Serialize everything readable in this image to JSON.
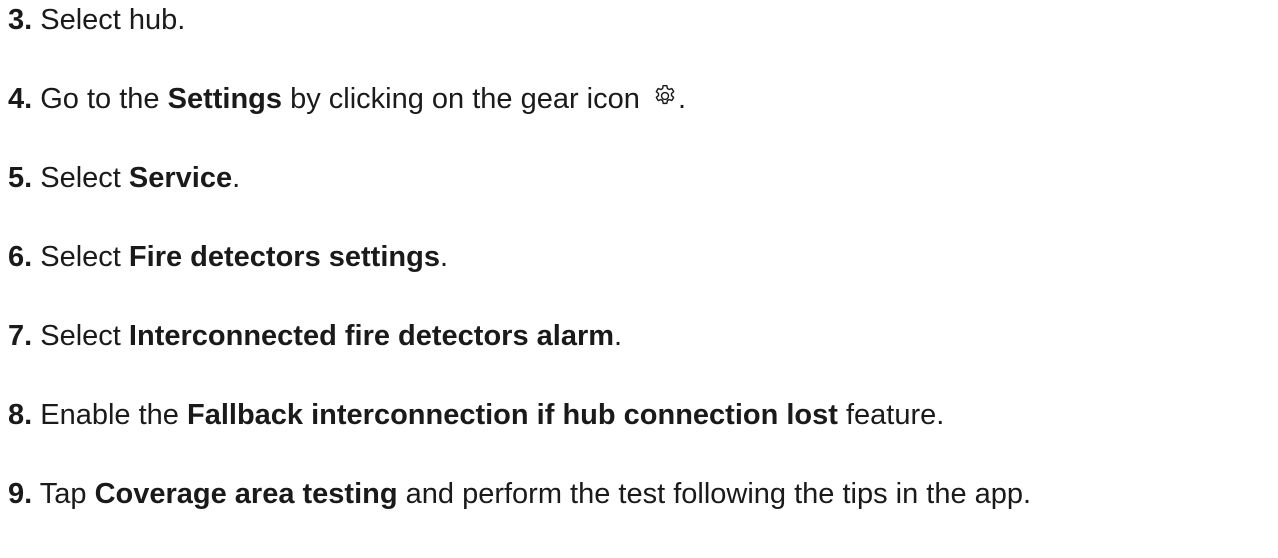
{
  "steps": [
    {
      "num": "3.",
      "parts": [
        {
          "t": "Select hub.",
          "b": false
        }
      ]
    },
    {
      "num": "4.",
      "parts": [
        {
          "t": "Go to the ",
          "b": false
        },
        {
          "t": "Settings",
          "b": true
        },
        {
          "t": " by clicking on the gear icon ",
          "b": false
        },
        {
          "icon": "gear-icon"
        },
        {
          "t": ".",
          "b": false
        }
      ]
    },
    {
      "num": "5.",
      "parts": [
        {
          "t": "Select ",
          "b": false
        },
        {
          "t": "Service",
          "b": true
        },
        {
          "t": ".",
          "b": false
        }
      ]
    },
    {
      "num": "6.",
      "parts": [
        {
          "t": "Select ",
          "b": false
        },
        {
          "t": "Fire detectors settings",
          "b": true
        },
        {
          "t": ".",
          "b": false
        }
      ]
    },
    {
      "num": "7.",
      "parts": [
        {
          "t": "Select ",
          "b": false
        },
        {
          "t": "Interconnected fire detectors alarm",
          "b": true
        },
        {
          "t": ".",
          "b": false
        }
      ]
    },
    {
      "num": "8.",
      "parts": [
        {
          "t": "Enable the ",
          "b": false
        },
        {
          "t": "Fallback interconnection if hub connection lost",
          "b": true
        },
        {
          "t": " feature.",
          "b": false
        }
      ]
    },
    {
      "num": "9.",
      "parts": [
        {
          "t": "Tap ",
          "b": false
        },
        {
          "t": "Coverage area testing",
          "b": true
        },
        {
          "t": " and perform the test following the tips in the app.",
          "b": false
        }
      ]
    }
  ],
  "colors": {
    "text": "#1a1a1a",
    "background": "#ffffff"
  }
}
